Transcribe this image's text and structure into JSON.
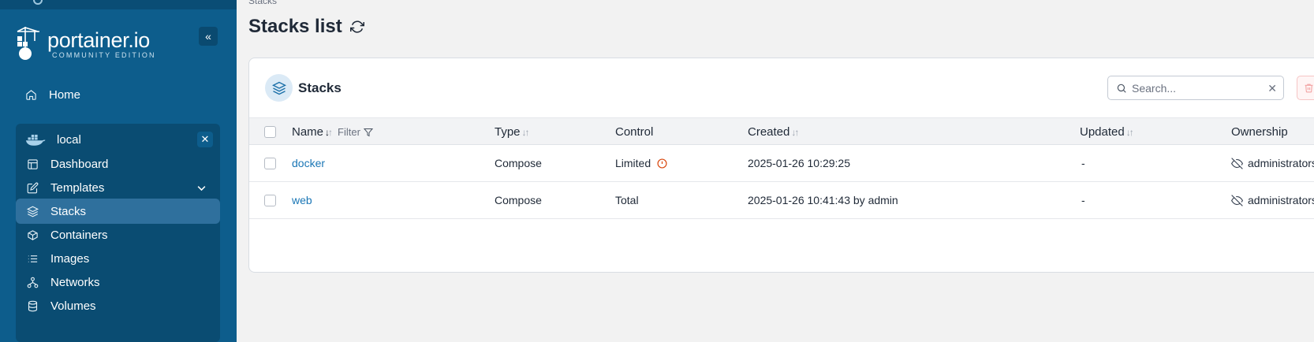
{
  "brand": {
    "name": "portainer.io",
    "edition": "COMMUNITY EDITION"
  },
  "sidebar": {
    "home_label": "Home",
    "environment": {
      "name": "local",
      "items": [
        {
          "label": "Dashboard",
          "icon": "dashboard-icon"
        },
        {
          "label": "Templates",
          "icon": "edit-icon"
        },
        {
          "label": "Stacks",
          "icon": "layers-icon"
        },
        {
          "label": "Containers",
          "icon": "box-icon"
        },
        {
          "label": "Images",
          "icon": "list-icon"
        },
        {
          "label": "Networks",
          "icon": "network-icon"
        },
        {
          "label": "Volumes",
          "icon": "database-icon"
        }
      ]
    }
  },
  "breadcrumb": "Stacks",
  "page_title": "Stacks list",
  "card": {
    "title": "Stacks",
    "search_placeholder": "Search...",
    "columns": {
      "name": "Name",
      "filter": "Filter",
      "type": "Type",
      "control": "Control",
      "created": "Created",
      "updated": "Updated",
      "ownership": "Ownership"
    },
    "rows": [
      {
        "name": "docker",
        "type": "Compose",
        "control": "Limited",
        "created": "2025-01-26 10:29:25",
        "updated": "-",
        "ownership": "administrators"
      },
      {
        "name": "web",
        "type": "Compose",
        "control": "Total",
        "created": "2025-01-26 10:41:43 by admin",
        "updated": "-",
        "ownership": "administrators"
      }
    ]
  },
  "colors": {
    "sidebar": "#0d5d8c",
    "env_box": "#0a4c72",
    "active_item": "#2f709d",
    "link": "#1a76b5",
    "warning": "#d9480f"
  }
}
